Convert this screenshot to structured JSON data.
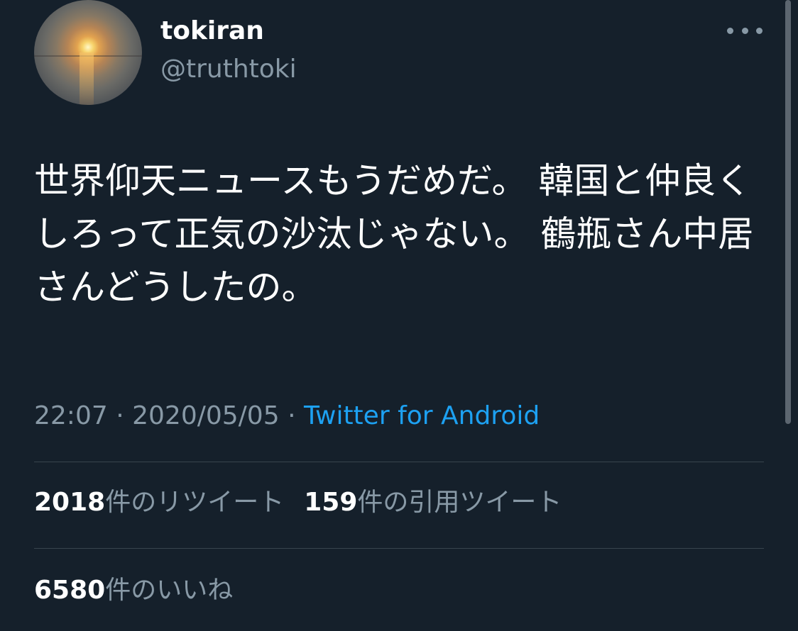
{
  "user": {
    "display_name": "tokiran",
    "username": "@truthtoki"
  },
  "tweet": {
    "text": "世界仰天ニュースもうだめだ。 韓国と仲良くしろって正気の沙汰じゃない。 鶴瓶さん中居さんどうしたの。",
    "time": "22:07",
    "separator": "·",
    "date": "2020/05/05",
    "source": "Twitter for Android"
  },
  "stats": {
    "retweets_count": "2018",
    "retweets_label": "件のリツイート",
    "quotes_count": "159",
    "quotes_label": "件の引用ツイート",
    "likes_count": "6580",
    "likes_label": "件のいいね"
  },
  "icons": {
    "more": "more-horizontal-icon"
  },
  "colors": {
    "background": "#15202b",
    "secondary_text": "#8899a6",
    "accent": "#1da1f2",
    "divider": "#38444d"
  }
}
